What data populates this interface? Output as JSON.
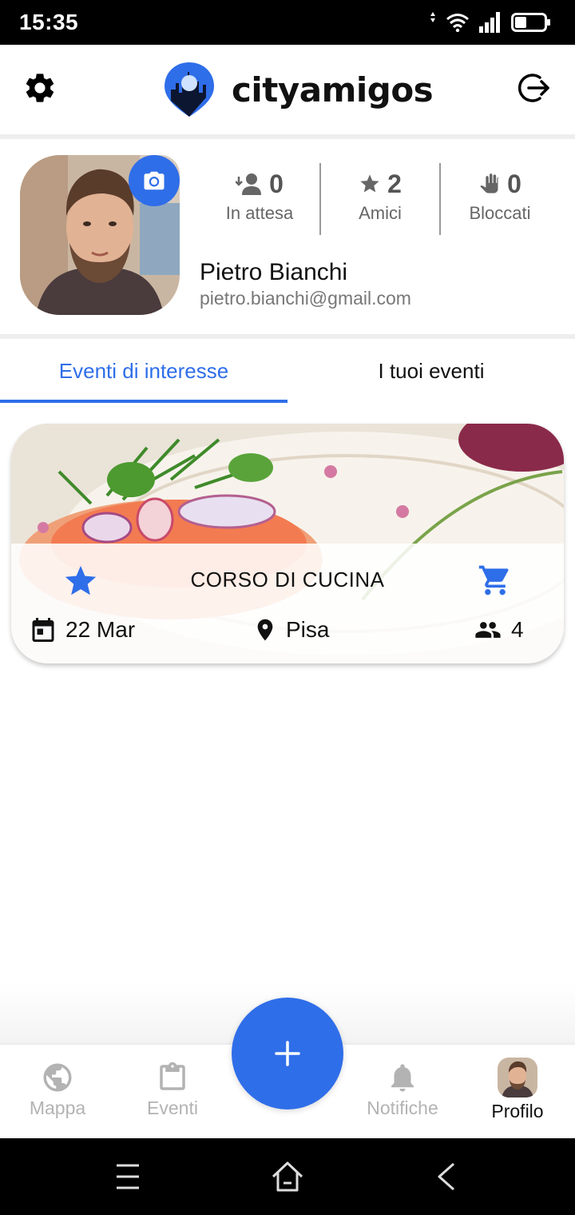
{
  "status_bar": {
    "time": "15:35",
    "icons": [
      "data-arrow-icon",
      "wifi-icon",
      "signal-icon",
      "battery-icon"
    ]
  },
  "header": {
    "app_name": "cityamigos",
    "left_icon": "gear-icon",
    "right_icon": "logout-icon"
  },
  "profile": {
    "name": "Pietro Bianchi",
    "email": "pietro.bianchi@gmail.com",
    "stats": [
      {
        "icon": "person-incoming-icon",
        "value": "0",
        "label": "In attesa"
      },
      {
        "icon": "star-icon",
        "value": "2",
        "label": "Amici"
      },
      {
        "icon": "hand-icon",
        "value": "0",
        "label": "Bloccati"
      }
    ]
  },
  "tabs": [
    {
      "label": "Eventi di interesse",
      "active": true
    },
    {
      "label": "I tuoi eventi",
      "active": false
    }
  ],
  "events": [
    {
      "title": "CORSO DI CUCINA",
      "date": "22 Mar",
      "place": "Pisa",
      "participants": "4",
      "favorite": true
    }
  ],
  "bottom_nav": {
    "items": [
      {
        "label": "Mappa",
        "icon": "globe-icon",
        "active": false
      },
      {
        "label": "Eventi",
        "icon": "clipboard-icon",
        "active": false
      },
      {
        "label": "Notifiche",
        "icon": "bell-icon",
        "active": false
      },
      {
        "label": "Profilo",
        "icon": "avatar",
        "active": true
      }
    ],
    "fab_label": "+"
  },
  "colors": {
    "accent": "#2f6ee9",
    "muted_text": "#777777",
    "inactive_nav": "#b3b3b3"
  }
}
